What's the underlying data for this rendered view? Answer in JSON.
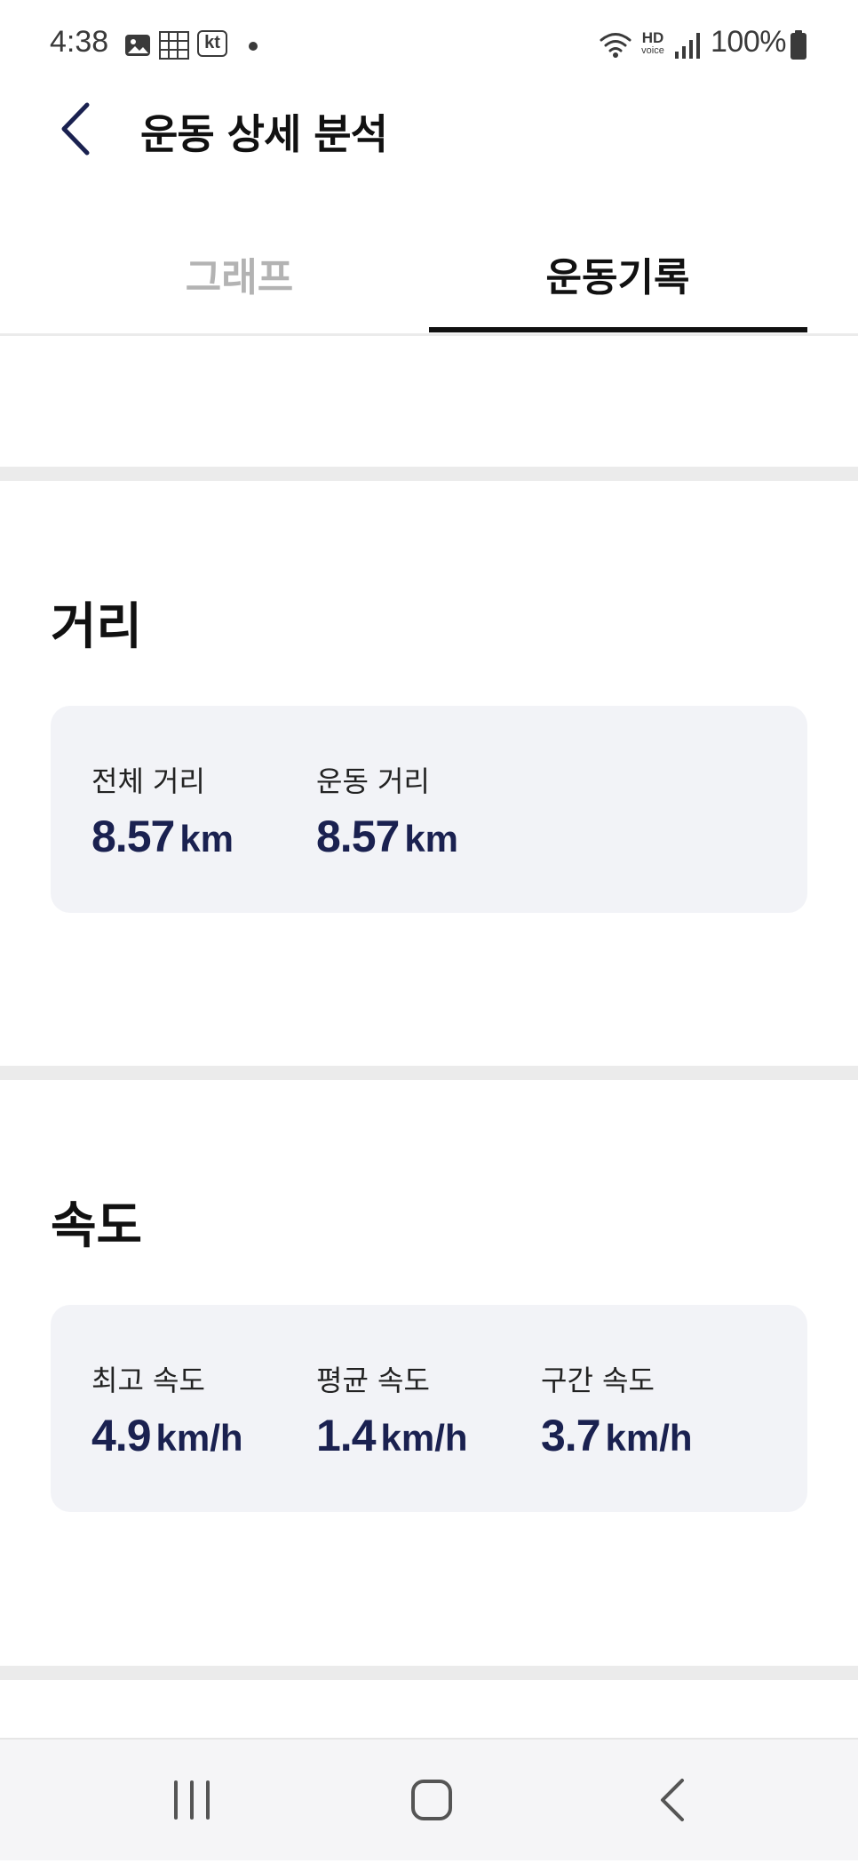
{
  "status_bar": {
    "time": "4:38",
    "battery": "100%",
    "carrier_badge": "kt",
    "hd_voice_top": "HD",
    "hd_voice_bottom": "voice",
    "icons": [
      "gallery-icon",
      "grid-icon",
      "kt-carrier-icon",
      "notification-dot-icon",
      "wifi-icon",
      "hd-voice-icon",
      "signal-icon",
      "battery-icon"
    ]
  },
  "header": {
    "title": "운동 상세 분석",
    "back_icon": "chevron-left-icon"
  },
  "tabs": [
    {
      "label": "그래프",
      "active": false
    },
    {
      "label": "운동기록",
      "active": true
    }
  ],
  "distance": {
    "title": "거리",
    "stats": [
      {
        "label": "전체 거리",
        "value": "8.57",
        "unit": "km"
      },
      {
        "label": "운동 거리",
        "value": "8.57",
        "unit": "km"
      }
    ]
  },
  "speed": {
    "title": "속도",
    "stats": [
      {
        "label": "최고 속도",
        "value": "4.9",
        "unit": "km/h"
      },
      {
        "label": "평균 속도",
        "value": "1.4",
        "unit": "km/h"
      },
      {
        "label": "구간 속도",
        "value": "3.7",
        "unit": "km/h"
      }
    ]
  },
  "nav_bar": {
    "icons": [
      "recent-apps-icon",
      "home-icon",
      "back-icon"
    ]
  },
  "colors": {
    "accent_dark_navy": "#1a2150",
    "card_background": "#f2f3f7",
    "inactive_tab": "#b3b3b3",
    "divider": "#ebebeb"
  }
}
